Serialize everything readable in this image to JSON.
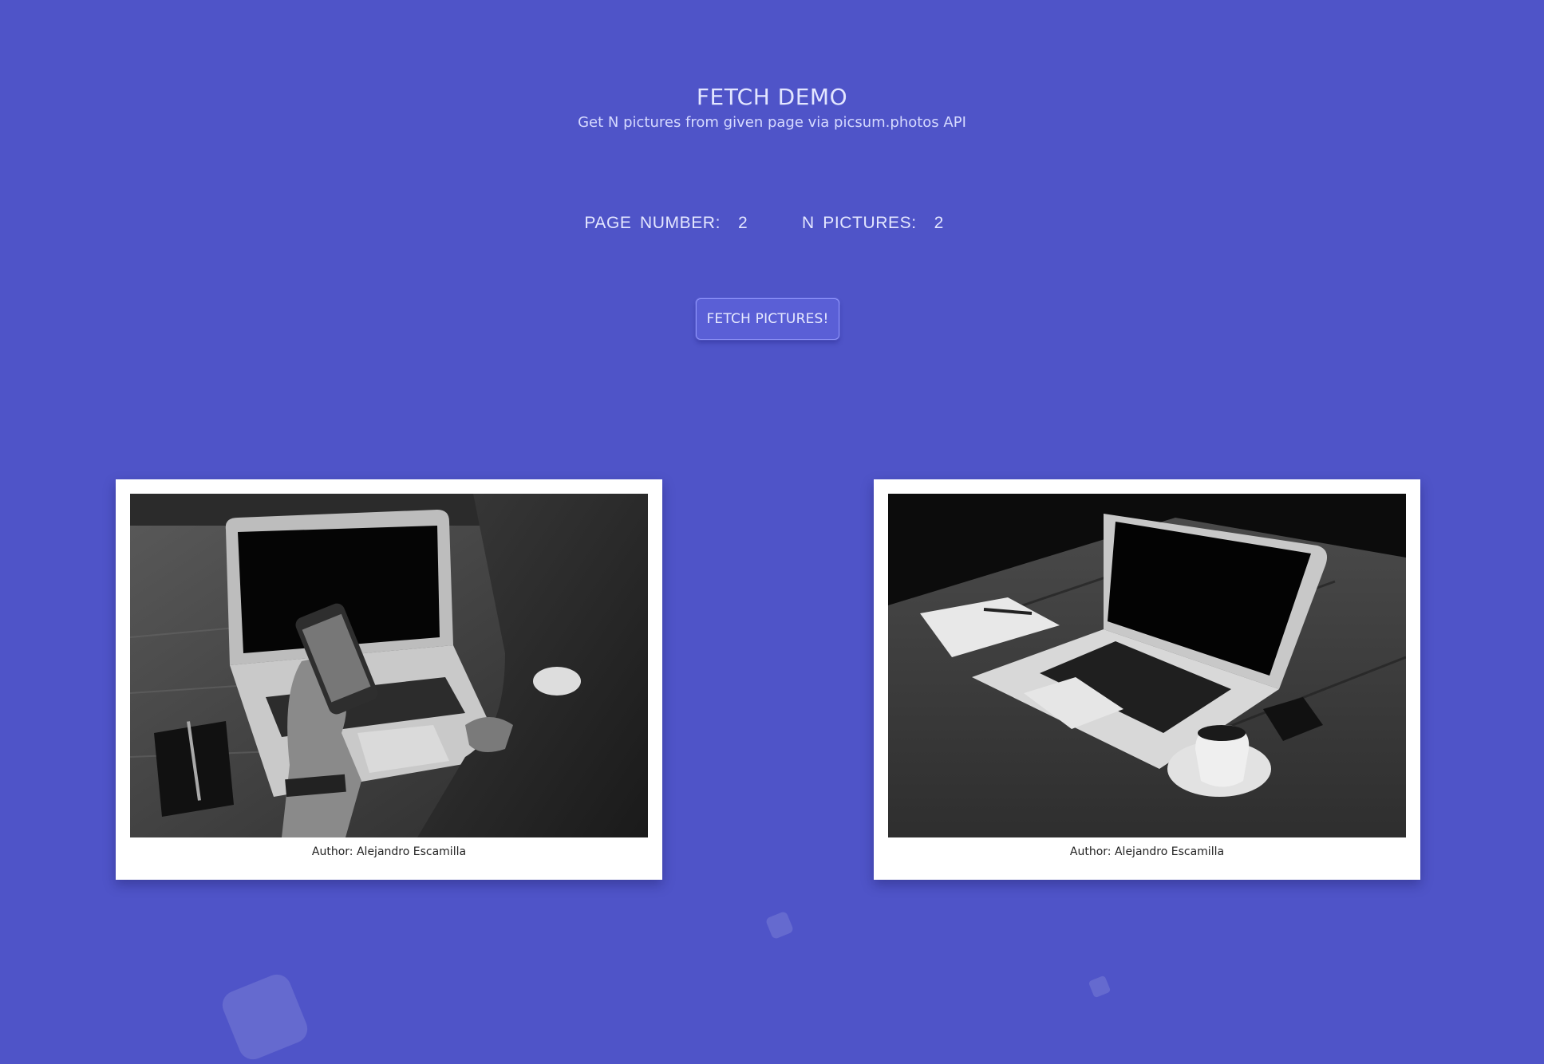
{
  "header": {
    "title": "FETCH DEMO",
    "subtitle": "Get N pictures from given page via picsum.photos API"
  },
  "controls": {
    "page_number_label": "PAGE NUMBER:",
    "page_number_value": "2",
    "n_pictures_label": "N PICTURES:",
    "n_pictures_value": "2"
  },
  "fetch_button": {
    "label": "FETCH PICTURES!"
  },
  "pictures": [
    {
      "caption": "Author: Alejandro Escamilla"
    },
    {
      "caption": "Author: Alejandro Escamilla"
    }
  ]
}
